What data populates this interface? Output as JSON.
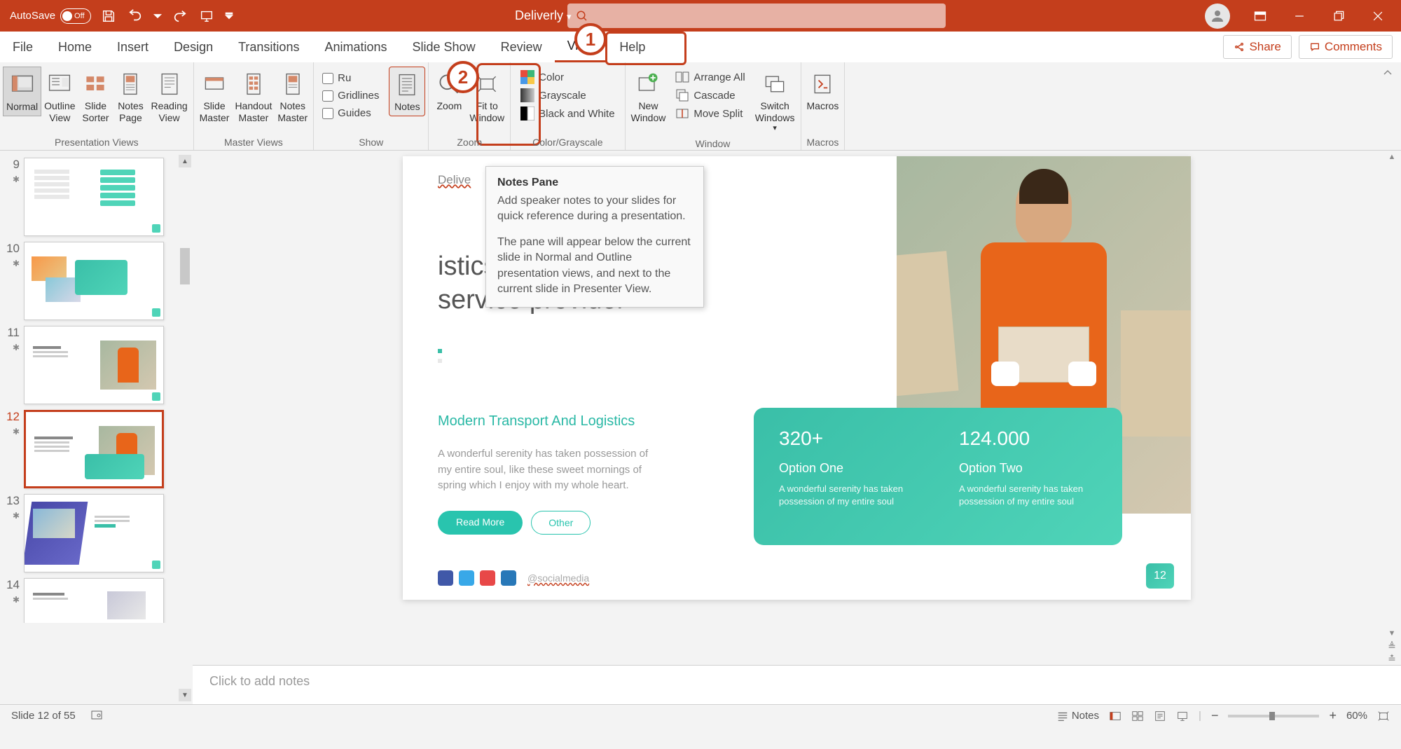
{
  "titlebar": {
    "autosave_label": "AutoSave",
    "autosave_state": "Off",
    "doc_title": "Deliverly"
  },
  "menubar": {
    "items": [
      "File",
      "Home",
      "Insert",
      "Design",
      "Transitions",
      "Animations",
      "Slide Show",
      "Review",
      "View",
      "Help"
    ],
    "share": "Share",
    "comments": "Comments"
  },
  "ribbon": {
    "presentation_views": {
      "label": "Presentation Views",
      "normal": "Normal",
      "outline": "Outline\nView",
      "sorter": "Slide\nSorter",
      "notes_page": "Notes\nPage",
      "reading": "Reading\nView"
    },
    "master_views": {
      "label": "Master Views",
      "slide": "Slide\nMaster",
      "handout": "Handout\nMaster",
      "notes": "Notes\nMaster"
    },
    "show": {
      "label": "Show",
      "ruler": "Ru",
      "gridlines": "Gridlines",
      "guides": "Guides",
      "notes": "Notes"
    },
    "zoom": {
      "label": "Zoom",
      "zoom_btn": "Zoom",
      "fit": "Fit to\nWindow"
    },
    "color": {
      "label": "Color/Grayscale",
      "color_btn": "Color",
      "grayscale": "Grayscale",
      "bw": "Black and White"
    },
    "window": {
      "label": "Window",
      "new": "New\nWindow",
      "arrange": "Arrange All",
      "cascade": "Cascade",
      "move_split": "Move Split",
      "switch": "Switch\nWindows"
    },
    "macros": {
      "label": "Macros",
      "btn": "Macros"
    }
  },
  "tooltip": {
    "title": "Notes Pane",
    "p1": "Add speaker notes to your slides for quick reference during a presentation.",
    "p2": "The pane will appear below the current slide in Normal and Outline presentation views, and next to the current slide in Presenter View."
  },
  "callout": {
    "one": "1",
    "two": "2"
  },
  "thumbnails": {
    "items": [
      {
        "num": "9"
      },
      {
        "num": "10"
      },
      {
        "num": "11"
      },
      {
        "num": "12",
        "active": true
      },
      {
        "num": "13"
      },
      {
        "num": "14"
      }
    ]
  },
  "slide": {
    "delive": "Delive",
    "heading_suffix": "istics\nservice provider",
    "subtitle": "Modern Transport And Logistics",
    "body": "A wonderful serenity has taken possession of my entire soul, like these sweet mornings of spring which I enjoy with my whole heart.",
    "read_more": "Read More",
    "other": "Other",
    "social_at": "@socialmedia",
    "card": {
      "num1": "320+",
      "opt1": "Option One",
      "desc1": "A wonderful serenity has taken possession of my entire soul",
      "num2": "124.000",
      "opt2": "Option Two",
      "desc2": "A wonderful serenity has taken possession of my entire soul"
    },
    "pagenum": "12"
  },
  "notes_placeholder": "Click to add notes",
  "statusbar": {
    "slide_of": "Slide 12 of 55",
    "notes_btn": "Notes",
    "zoom_pct": "60%"
  }
}
